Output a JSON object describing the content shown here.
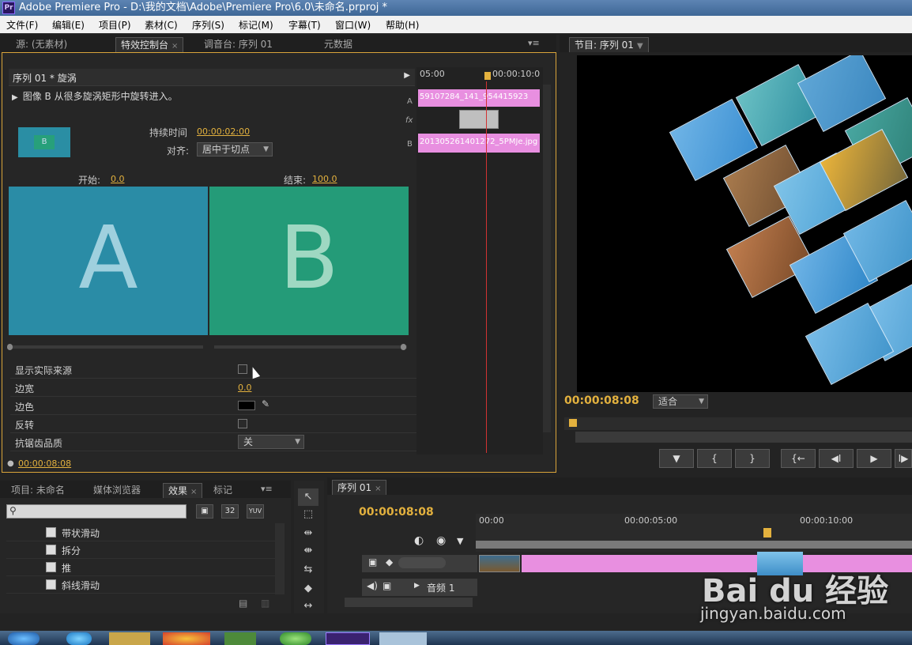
{
  "window": {
    "title": "Adobe Premiere Pro - D:\\我的文档\\Adobe\\Premiere Pro\\6.0\\未命名.prproj *",
    "app_icon": "Pr"
  },
  "menu": [
    "文件(F)",
    "编辑(E)",
    "项目(P)",
    "素材(C)",
    "序列(S)",
    "标记(M)",
    "字幕(T)",
    "窗口(W)",
    "帮助(H)"
  ],
  "source_panel": {
    "tabs": [
      {
        "label": "源: (无素材)"
      },
      {
        "label": "特效控制台",
        "active": true,
        "close": "×"
      },
      {
        "label": "调音台: 序列 01"
      },
      {
        "label": "元数据"
      }
    ],
    "header": "序列 01 * 旋涡",
    "description": "图像 B 从很多旋涡矩形中旋转进入。",
    "preview_letter": "B",
    "duration_label": "持续时间",
    "duration_value": "00:00:02:00",
    "align_label": "对齐:",
    "align_value": "居中于切点",
    "start_label": "开始:",
    "start_value": "0.0",
    "end_label": "结束:",
    "end_value": "100.0",
    "letter_a": "A",
    "letter_b": "B",
    "properties": [
      {
        "label": "显示实际来源",
        "kind": "checkbox"
      },
      {
        "label": "边宽",
        "kind": "value",
        "value": "0.0"
      },
      {
        "label": "边色",
        "kind": "color"
      },
      {
        "label": "反转",
        "kind": "checkbox"
      },
      {
        "label": "抗锯齿品质",
        "kind": "dropdown",
        "value": "关"
      }
    ],
    "timecode": "00:00:08:08",
    "mini_timeline": {
      "ruler_left": "05:00",
      "ruler_right": "00:00:10:0",
      "track_a": "A",
      "track_fx": "fx",
      "track_b": "B",
      "clip_a": "59107284_141_954415923",
      "clip_b": "201305261401272_5PMJe.jpg"
    }
  },
  "program_panel": {
    "tab": "节目: 序列 01",
    "timecode": "00:00:08:08",
    "fit": "适合",
    "buttons": [
      "▼",
      "{",
      "}",
      "{←",
      "◀I",
      "▶",
      "I▶"
    ]
  },
  "effects_panel": {
    "tabs": [
      {
        "label": "项目: 未命名"
      },
      {
        "label": "媒体浏览器"
      },
      {
        "label": "效果",
        "active": true,
        "close": "×"
      },
      {
        "label": "标记"
      }
    ],
    "icon_labels": [
      "32",
      "YUV"
    ],
    "items": [
      "带状滑动",
      "拆分",
      "推",
      "斜线滑动"
    ]
  },
  "timeline_panel": {
    "tab": "序列 01",
    "close": "×",
    "timecode": "00:00:08:08",
    "ruler": [
      "00:00",
      "00:00:05:00",
      "00:00:10:00"
    ],
    "audio_track": "音频 1"
  },
  "watermark": {
    "logo": "Bai du 经验",
    "url": "jingyan.baidu.com"
  }
}
